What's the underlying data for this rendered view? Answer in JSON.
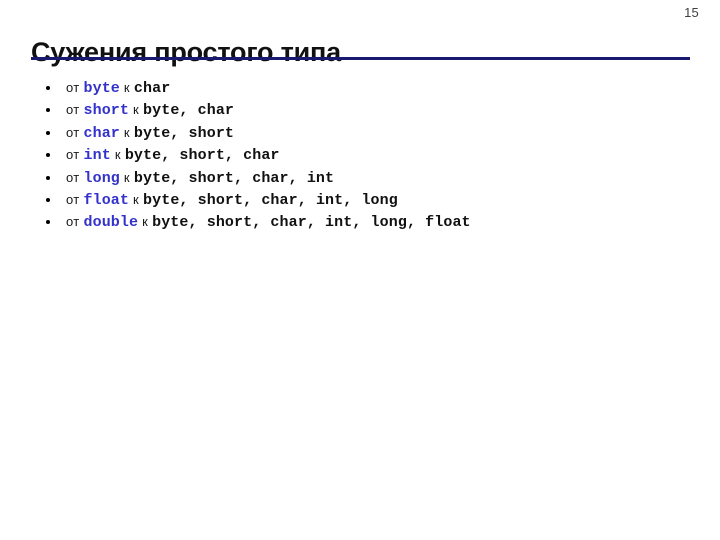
{
  "slide": {
    "page_number": "15",
    "title": "Сужения простого типа",
    "rule_color": "#191970",
    "source_color": "#3333cc",
    "target_color": "#111111",
    "background_color": "#ffffff",
    "from_word": "от",
    "to_word": "к"
  },
  "bullets": [
    {
      "from_label": "от",
      "source": "byte",
      "to_label": "к",
      "targets": "char"
    },
    {
      "from_label": "от",
      "source": "short",
      "to_label": "к",
      "targets": "byte, char"
    },
    {
      "from_label": "от",
      "source": "char",
      "to_label": "к",
      "targets": "byte, short"
    },
    {
      "from_label": "от",
      "source": "int",
      "to_label": "к",
      "targets": "byte, short, char"
    },
    {
      "from_label": "от",
      "source": "long",
      "to_label": "к",
      "targets": "byte, short, char, int"
    },
    {
      "from_label": "от",
      "source": "float",
      "to_label": "к",
      "targets": "byte, short, char, int, long"
    },
    {
      "from_label": "от",
      "source": "double",
      "to_label": "к",
      "targets": "byte, short, char, int, long, float"
    }
  ]
}
